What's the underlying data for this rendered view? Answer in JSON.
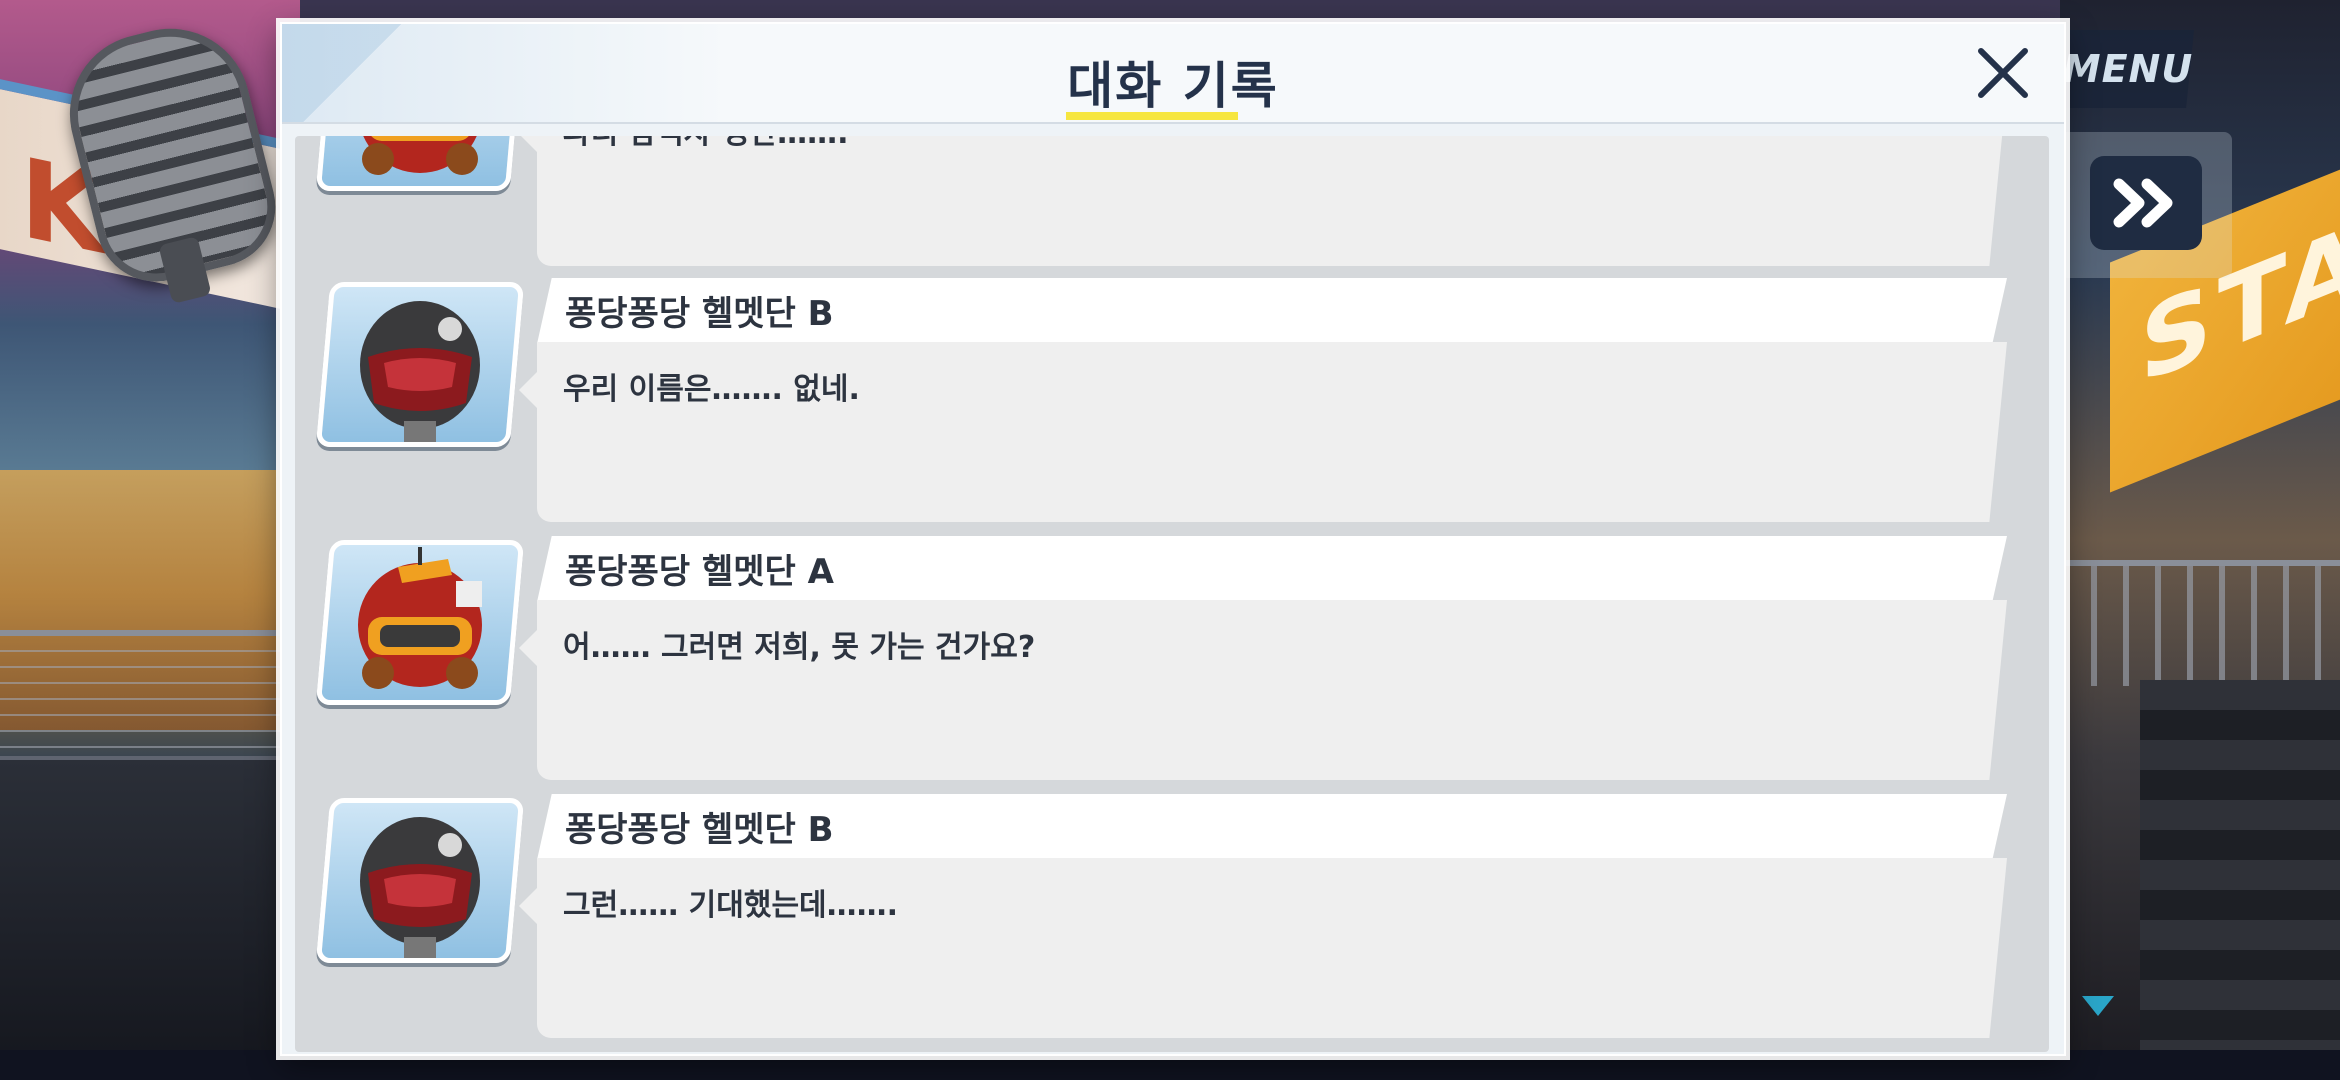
{
  "modal": {
    "title": "대화 기록",
    "close_icon": "close-icon",
    "title_underline_color": "#f6e640"
  },
  "controls": {
    "menu_label": "MENU",
    "skip_icon": "fast-forward-icon",
    "scroll_indicator_icon": "triangle-down-icon"
  },
  "background": {
    "sign_left_text": "KA",
    "sign_right_text": "STA"
  },
  "log": [
    {
      "speaker": "",
      "avatar": "red-helmet-avatar",
      "line": "파티 참석자 명단……."
    },
    {
      "speaker": "퐁당퐁당 헬멧단 B",
      "avatar": "black-helmet-avatar",
      "line": "우리 이름은……. 없네."
    },
    {
      "speaker": "퐁당퐁당 헬멧단 A",
      "avatar": "red-helmet-avatar",
      "line": "어…… 그러면 저희, 못 가는 건가요?"
    },
    {
      "speaker": "퐁당퐁당 헬멧단 B",
      "avatar": "black-helmet-avatar",
      "line": "그런…… 기대했는데……."
    }
  ]
}
